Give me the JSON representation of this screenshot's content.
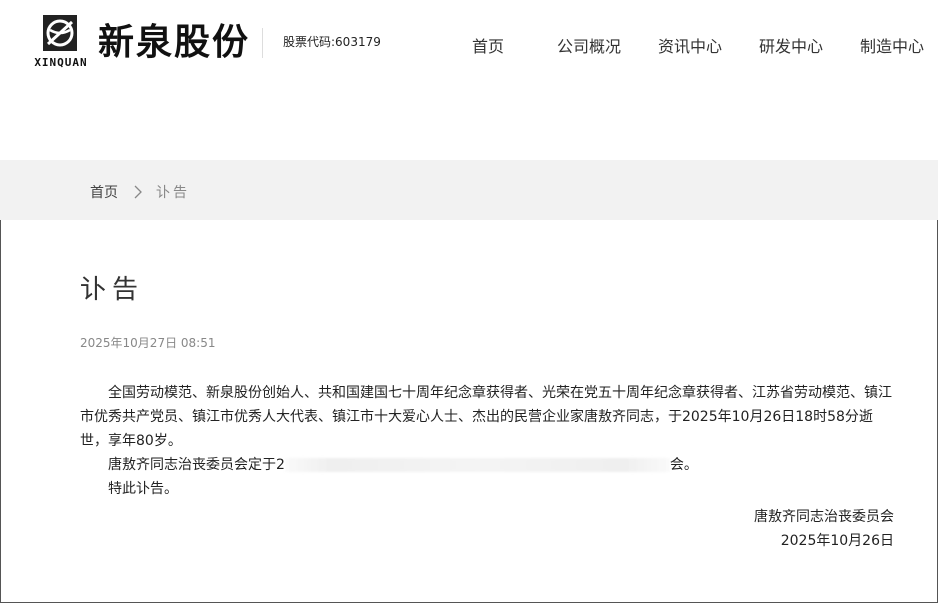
{
  "header": {
    "logo_text": "XINQUAN",
    "brand": "新泉股份",
    "stock_code": "股票代码:603179",
    "nav": [
      {
        "label": "首页"
      },
      {
        "label": "公司概况"
      },
      {
        "label": "资讯中心"
      },
      {
        "label": "研发中心"
      },
      {
        "label": "制造中心"
      }
    ]
  },
  "breadcrumb": {
    "home": "首页",
    "current": "讣告"
  },
  "article": {
    "title": "讣告",
    "date": "2025年10月27日 08:51",
    "paragraph1": "全国劳动模范、新泉股份创始人、共和国建国七十周年纪念章获得者、光荣在党五十周年纪念章获得者、江苏省劳动模范、镇江市优秀共产党员、镇江市优秀人大代表、镇江市十大爱心人士、杰出的民营企业家唐敖齐同志，于2025年10月26日18时58分逝世，享年80岁。",
    "paragraph2_start": "唐敖齐同志治丧委员会定于2",
    "paragraph2_end": "会。",
    "paragraph3": "特此讣告。",
    "signature_org": "唐敖齐同志治丧委员会",
    "signature_date": "2025年10月26日"
  }
}
